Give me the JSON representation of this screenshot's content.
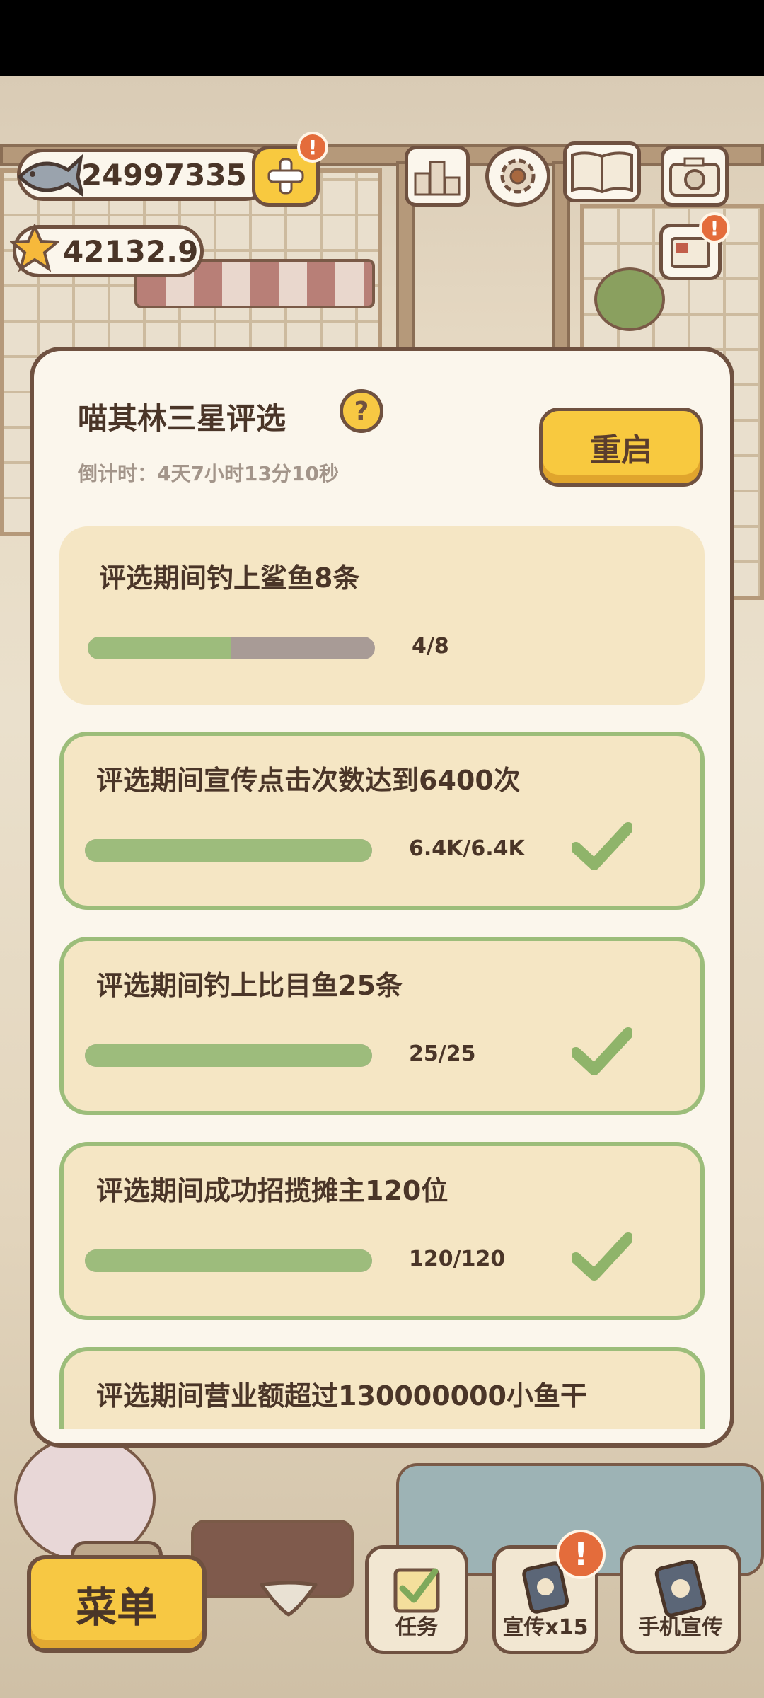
{
  "currency": {
    "fish_amount": "24997335",
    "star_amount": "42132.9",
    "plus_badge": "!"
  },
  "top_icons": {
    "leaderboard_icon": "ranking-icon",
    "settings_icon": "gear-icon",
    "book_icon": "book-icon",
    "camera_icon": "camera-icon",
    "postcard_badge": "!"
  },
  "dialog": {
    "title": "喵其林三星评选",
    "help_label": "?",
    "countdown": "倒计时：4天7小时13分10秒",
    "restart_label": "重启",
    "tasks": [
      {
        "name": "评选期间钓上鲨鱼8条",
        "progress_text": "4/8",
        "progress": 0.5,
        "completed": false
      },
      {
        "name": "评选期间宣传点击次数达到6400次",
        "progress_text": "6.4K/6.4K",
        "progress": 1.0,
        "completed": true
      },
      {
        "name": "评选期间钓上比目鱼25条",
        "progress_text": "25/25",
        "progress": 1.0,
        "completed": true
      },
      {
        "name": "评选期间成功招揽摊主120位",
        "progress_text": "120/120",
        "progress": 1.0,
        "completed": true
      },
      {
        "name": "评选期间营业额超过130000000小鱼干",
        "progress_text": "",
        "progress": 0,
        "completed": false
      }
    ]
  },
  "bottom_bar": {
    "menu_label": "菜单",
    "tasks_label": "任务",
    "promote_label": "宣传x15",
    "promote_badge": "!",
    "phone_promote_label": "手机宣传"
  },
  "colors": {
    "accent_yellow": "#f8c93f",
    "border_brown": "#6f5140",
    "progress_green": "#9dbc7c",
    "progress_empty": "#a89b96",
    "card_bg": "#f5e6c4",
    "panel_bg": "#fbf6ec"
  }
}
